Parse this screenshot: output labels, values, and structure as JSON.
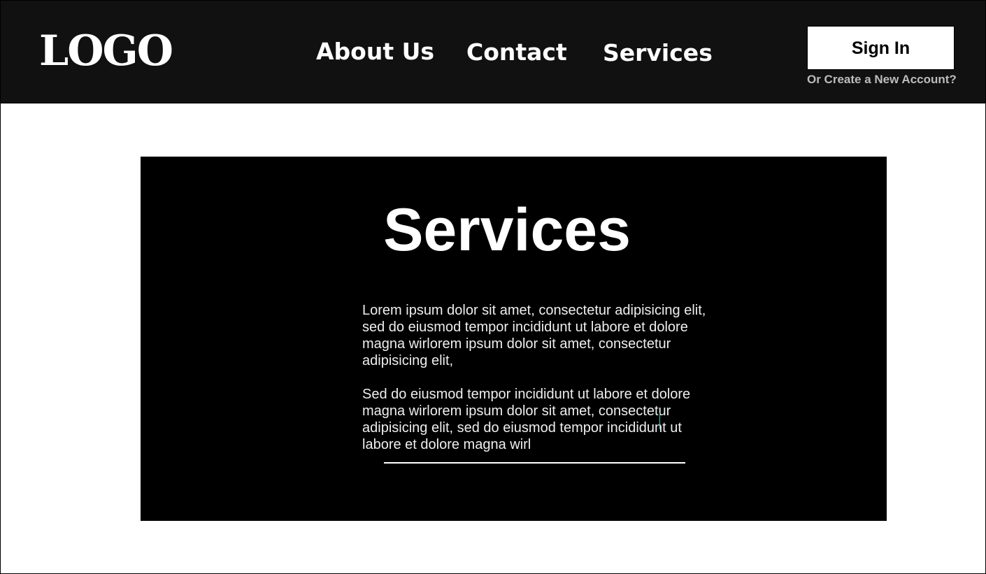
{
  "header": {
    "logo": "LOGO",
    "nav": [
      {
        "label": "About Us"
      },
      {
        "label": "Contact"
      },
      {
        "label": "Services"
      }
    ],
    "sign_in_label": "Sign In",
    "create_account_label": "Or Create a New Account?"
  },
  "hero": {
    "title": "Services",
    "paragraphs": [
      "Lorem ipsum dolor sit amet, consectetur adipisicing elit,\nsed do eiusmod tempor incididunt ut labore et dolore\nmagna wirlorem ipsum dolor sit amet, consectetur\nadipisicing elit,",
      "Sed do eiusmod tempor incididunt ut labore et dolore\nmagna wirlorem ipsum dolor sit amet, consectetur\nadipisicing elit, sed do eiusmod tempor incididunt ut\nlabore et dolore magna wirl"
    ]
  },
  "colors": {
    "header_bg": "#111111",
    "hero_bg": "#000000",
    "page_bg": "#ffffff",
    "accent_cursor": "#4fc3c8",
    "link_muted": "#bdbdbd"
  }
}
